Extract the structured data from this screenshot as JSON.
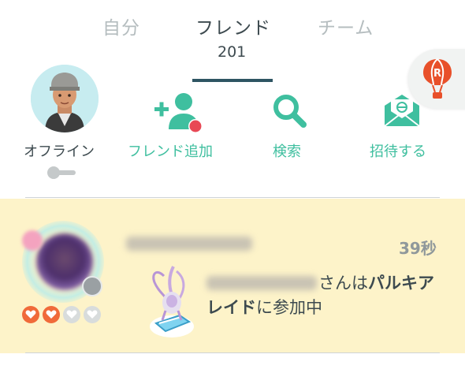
{
  "tabs": {
    "self": "自分",
    "friend": "フレンド",
    "team": "チーム",
    "active": "friend"
  },
  "friend_count": "201",
  "profile": {
    "status_label": "オフライン",
    "online_toggle": "off"
  },
  "actions": {
    "add_friend": "フレンド追加",
    "search": "検索",
    "invite": "招待する"
  },
  "friends": [
    {
      "time": "39秒",
      "name_visible": false,
      "activity_suffix": "さんは",
      "activity_raid": "パルキアレイド",
      "activity_end": "に参加中",
      "hearts_filled": 2,
      "hearts_total": 4
    }
  ],
  "colors": {
    "accent_teal": "#3fbf9f",
    "tab_active": "#3d4a4f",
    "tab_inactive": "#b5bdbf",
    "tab_underline": "#2e5563",
    "row_highlight": "#fdf3c9",
    "heart_filled": "#f06a3a",
    "notification_dot": "#e84855",
    "balloon_icon": "#e8502a"
  },
  "icons": {
    "balloon": "team-rocket-balloon-icon",
    "add_friend": "add-friend-icon",
    "search": "search-icon",
    "invite": "invite-envelope-icon"
  }
}
